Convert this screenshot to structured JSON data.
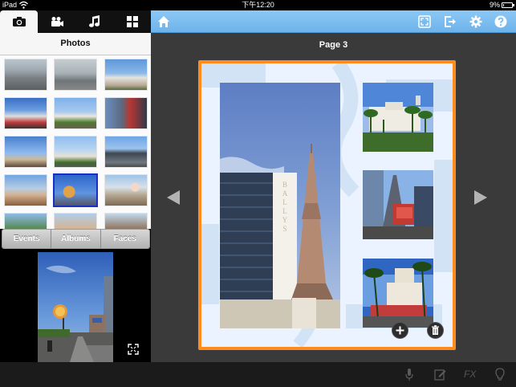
{
  "status_bar": {
    "carrier": "iPad",
    "time": "下午12:20",
    "battery": "9%",
    "battery_level": 0.09
  },
  "media_tabs": [
    {
      "name": "camera-icon",
      "active": true
    },
    {
      "name": "video-icon",
      "active": false
    },
    {
      "name": "music-icon",
      "active": false
    },
    {
      "name": "grid-icon",
      "active": false
    }
  ],
  "photos_panel": {
    "title": "Photos",
    "segments": [
      "Events",
      "Albums",
      "Faces"
    ]
  },
  "toolbar": {
    "icons": [
      "home-icon",
      "fit-screen-icon",
      "export-icon",
      "settings-icon",
      "help-icon"
    ]
  },
  "canvas": {
    "page_label": "Page 3"
  },
  "bottom_bar": {
    "icons": [
      "microphone-icon",
      "edit-icon",
      "fx-label",
      "lightbulb-icon"
    ],
    "fx_label": "FX"
  },
  "colors": {
    "toolbar_blue": "#79bdf0",
    "page_border": "#ff8a1d",
    "canvas_bg": "#3a3a3a"
  }
}
